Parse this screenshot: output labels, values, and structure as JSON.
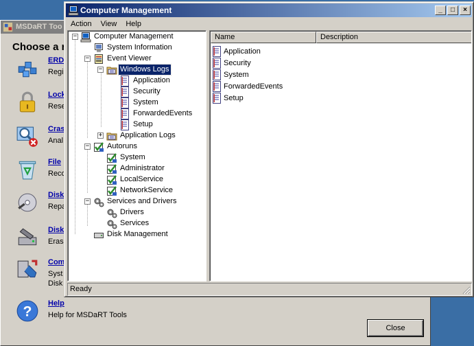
{
  "background_window": {
    "title": "MSDaRT Too",
    "heading": "Choose a re",
    "tools": [
      {
        "name": "ERD",
        "desc": "Regi",
        "icon": "erd-registry-icon"
      },
      {
        "name": "Lock",
        "desc": "Rese",
        "icon": "padlock-icon"
      },
      {
        "name": "Cras",
        "desc": "Anal",
        "icon": "crash-analyzer-icon"
      },
      {
        "name": "File",
        "desc": "Reco",
        "icon": "recycle-bin-icon"
      },
      {
        "name": "Disk",
        "desc": "Repa",
        "icon": "disk-icon"
      },
      {
        "name": "Disk",
        "desc": "Eras",
        "icon": "disk-wipe-icon"
      },
      {
        "name": "Com",
        "desc": "Syst\nDisk",
        "icon": "computer-management-tools-icon"
      },
      {
        "name": "Help",
        "desc": "Help for MSDaRT Tools",
        "icon": "help-icon"
      }
    ],
    "close_label": "Close"
  },
  "window": {
    "title": "Computer Management",
    "menu": [
      "Action",
      "View",
      "Help"
    ],
    "caption_buttons": {
      "minimize": "_",
      "maximize": "□",
      "close": "×"
    }
  },
  "tree": {
    "root": "Computer Management",
    "system_information": "System Information",
    "event_viewer": "Event Viewer",
    "windows_logs": "Windows Logs",
    "windows_logs_children": [
      "Application",
      "Security",
      "System",
      "ForwardedEvents",
      "Setup"
    ],
    "application_logs": "Application Logs",
    "autoruns": "Autoruns",
    "autoruns_children": [
      "System",
      "Administrator",
      "LocalService",
      "NetworkService"
    ],
    "services_and_drivers": "Services and Drivers",
    "services_children": [
      "Drivers",
      "Services"
    ],
    "disk_management": "Disk Management"
  },
  "list": {
    "columns": [
      "Name",
      "Description"
    ],
    "rows": [
      "Application",
      "Security",
      "System",
      "ForwardedEvents",
      "Setup"
    ]
  },
  "status": "Ready",
  "colors": {
    "title_active": "#0a246a",
    "selection": "#0a246a",
    "face": "#d4d0c8"
  }
}
